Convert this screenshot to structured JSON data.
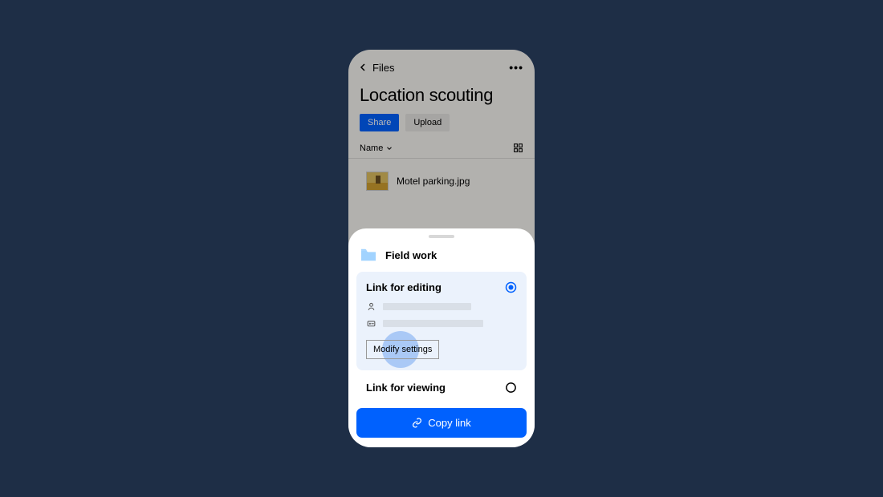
{
  "header": {
    "back_label": "Files"
  },
  "page": {
    "title": "Location scouting"
  },
  "actions": {
    "share": "Share",
    "upload": "Upload"
  },
  "list": {
    "sort_label": "Name",
    "first_file": "Motel parking.jpg"
  },
  "sheet": {
    "folder_name": "Field work",
    "option_editing": "Link for editing",
    "option_viewing": "Link for viewing",
    "modify_settings": "Modify settings",
    "copy_link": "Copy link"
  },
  "colors": {
    "accent": "#0061fe",
    "bg": "#1e2e46"
  }
}
